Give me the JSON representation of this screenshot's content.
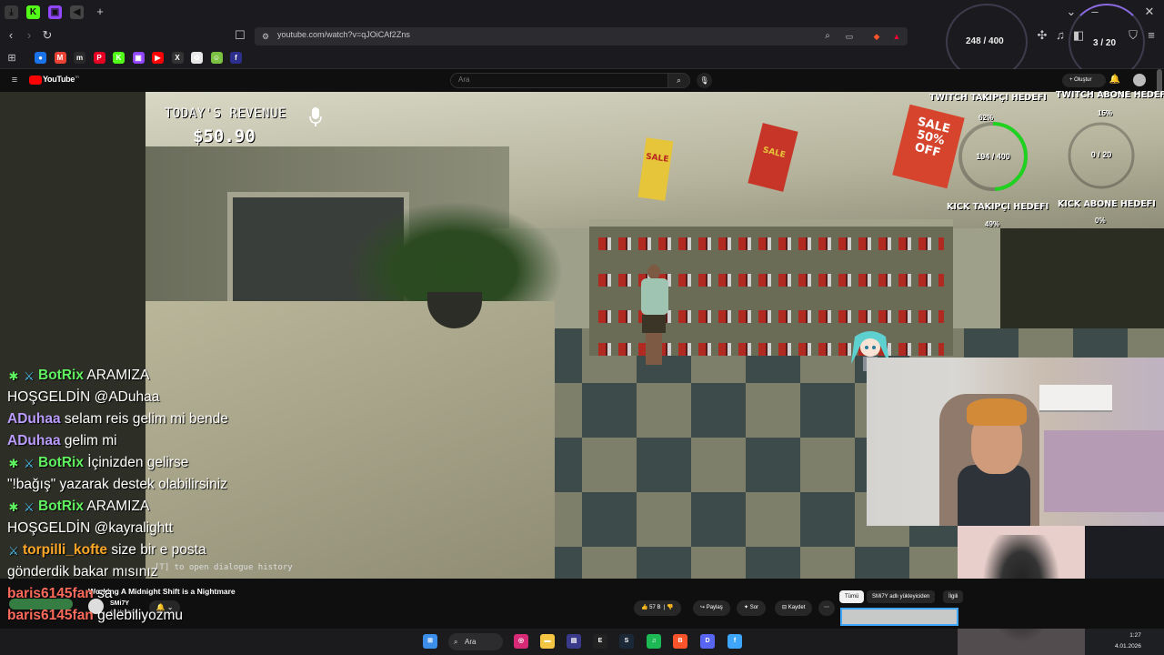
{
  "browser": {
    "url": "youtube.com/watch?v=qJOiCAf2Zns",
    "tab_icons": [
      {
        "icon": "download-icon",
        "color": "#3a3a3a",
        "glyph": "⤓"
      },
      {
        "icon": "kick-icon",
        "color": "#53fc18",
        "glyph": "K"
      },
      {
        "icon": "twitch-icon",
        "color": "#9146ff",
        "glyph": "▣"
      },
      {
        "icon": "audio-tab-icon",
        "color": "#444",
        "glyph": "◀"
      }
    ],
    "new_tab_glyph": "+",
    "bookmarks": [
      {
        "icon": "maps-icon",
        "color": "#1a73e8",
        "glyph": "●"
      },
      {
        "icon": "gmail-icon",
        "color": "#ea4335",
        "glyph": "M"
      },
      {
        "icon": "site-icon",
        "color": "#2a2a2a",
        "glyph": "m"
      },
      {
        "icon": "pinterest-icon",
        "color": "#e60023",
        "glyph": "P"
      },
      {
        "icon": "kick-icon",
        "color": "#53fc18",
        "glyph": "K"
      },
      {
        "icon": "twitch-icon",
        "color": "#9146ff",
        "glyph": "▣"
      },
      {
        "icon": "youtube-icon",
        "color": "#ff0000",
        "glyph": "▶"
      },
      {
        "icon": "x-icon",
        "color": "#333",
        "glyph": "X"
      },
      {
        "icon": "site-icon",
        "color": "#e8e8e8",
        "glyph": "✿"
      },
      {
        "icon": "site-icon",
        "color": "#7cc242",
        "glyph": "☺"
      },
      {
        "icon": "site-icon",
        "color": "#2c2f8c",
        "glyph": "f"
      }
    ]
  },
  "youtube": {
    "logo_text": "YouTube",
    "logo_suffix": "TR",
    "search_placeholder": "Ara",
    "create_label": "Oluştur",
    "video_title": "Working A Midnight Shift is a Nightmare",
    "channel_name": "SMi7Y",
    "channel_subs": "4,9 Mn abone",
    "like_count": "57 B",
    "share_label": "Paylaş",
    "ask_label": "Sor",
    "save_label": "Kaydet",
    "chips": [
      "Tümü",
      "SMi7Y adlı yükleyiciden",
      "İlgili"
    ]
  },
  "game": {
    "revenue_label": "TODAY'S REVENUE",
    "revenue_value": "$50.90",
    "dialogue_hint": "[T] to open dialogue history",
    "signs": [
      "SALE",
      "SALE",
      "SALE 50% OFF"
    ]
  },
  "goals": {
    "top_follow_count": "248 / 400",
    "top_sub_count": "3 / 20",
    "twitch_follow_title": "TWITCH TAKIPÇI HEDEFI",
    "twitch_follow_pct": "62%",
    "twitch_follow_fraction": 0.62,
    "twitch_sub_title": "TWITCH ABONE HEDEFI",
    "twitch_sub_pct": "15%",
    "kick_follow_title": "KICK TAKIPÇI HEDEFI",
    "kick_follow_pct": "49%",
    "kick_follow_count": "194 / 400",
    "kick_follow_fraction": 0.49,
    "kick_sub_title": "KICK ABONE HEDEFI",
    "kick_sub_pct": "0%",
    "kick_sub_count": "0 / 20",
    "ring_color": "#1fd21f"
  },
  "chat": {
    "user_colors": {
      "BotRix": "#5ef25e",
      "ADuhaa": "#b99cff",
      "torpilli_kofte": "#ffa726",
      "baris6145fan": "#ff6b5a"
    },
    "lines": [
      {
        "badges": true,
        "user": "BotRix",
        "color": "#5ef25e",
        "text": " ARAMIZA"
      },
      {
        "badges": false,
        "user": "",
        "color": "#fff",
        "text": "HOŞGELDİN @ADuhaa"
      },
      {
        "badges": false,
        "user": "ADuhaa",
        "color": "#b99cff",
        "text": " selam reis gelim mi bende"
      },
      {
        "badges": false,
        "user": "ADuhaa",
        "color": "#b99cff",
        "text": " gelim mi"
      },
      {
        "badges": true,
        "user": "BotRix",
        "color": "#5ef25e",
        "text": " İçinizden gelirse"
      },
      {
        "badges": false,
        "user": "",
        "color": "#fff",
        "text": "\"!bağış\" yazarak destek olabilirsiniz"
      },
      {
        "badges": true,
        "user": "BotRix",
        "color": "#5ef25e",
        "text": " ARAMIZA"
      },
      {
        "badges": false,
        "user": "",
        "color": "#fff",
        "text": "HOŞGELDİN @kayralightt"
      },
      {
        "badges": "sword",
        "user": "torpilli_kofte",
        "color": "#ffa726",
        "text": " size bir e posta"
      },
      {
        "badges": false,
        "user": "",
        "color": "#fff",
        "text": "gönderdik bakar mısınız"
      },
      {
        "badges": false,
        "user": "baris6145fan",
        "color": "#ff6b5a",
        "text": " sa"
      },
      {
        "badges": false,
        "user": "baris6145fan",
        "color": "#ff6b5a",
        "text": " gelebiliyozmu"
      }
    ]
  },
  "taskbar": {
    "search_label": "Ara",
    "clock_time": "1:27",
    "clock_date": "4.01.2026",
    "apps": [
      {
        "icon": "windows-start-icon",
        "color": "#3b8eea",
        "glyph": "⊞"
      },
      {
        "icon": "instagram-icon",
        "color": "#d62976",
        "glyph": "◎"
      },
      {
        "icon": "folder-icon",
        "color": "#f4c542",
        "glyph": "▬"
      },
      {
        "icon": "app-icon",
        "color": "#3a3a8a",
        "glyph": "▤"
      },
      {
        "icon": "epic-games-icon",
        "color": "#222",
        "glyph": "E"
      },
      {
        "icon": "steam-icon",
        "color": "#1b2838",
        "glyph": "S"
      },
      {
        "icon": "spotify-icon",
        "color": "#1db954",
        "glyph": "♫"
      },
      {
        "icon": "brave-icon",
        "color": "#fb542b",
        "glyph": "B"
      },
      {
        "icon": "discord-icon",
        "color": "#5865f2",
        "glyph": "D"
      },
      {
        "icon": "app-icon",
        "color": "#3ea6ff",
        "glyph": "f"
      }
    ]
  }
}
